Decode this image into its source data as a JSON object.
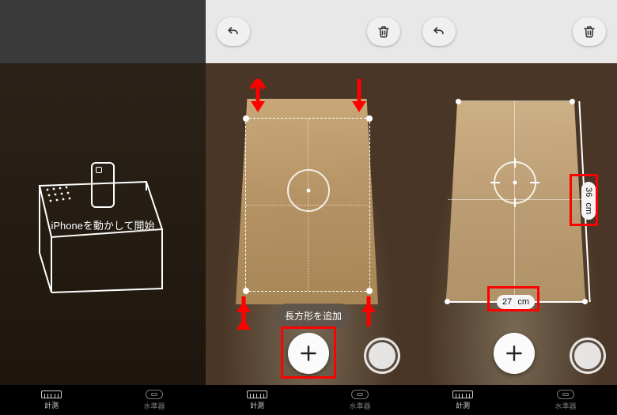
{
  "tabs": {
    "measure": "計測",
    "level": "水準器"
  },
  "panel1": {
    "instruction": "iPhoneを動かして開始"
  },
  "panel2": {
    "tooltip": "長方形を追加",
    "icons": {
      "undo": "undo-icon",
      "trash": "trash-icon",
      "plus": "plus-icon",
      "shutter": "shutter-icon"
    }
  },
  "panel3": {
    "measurements": {
      "width": {
        "value": "27",
        "unit": "cm"
      },
      "height": {
        "value": "36",
        "unit": "cm"
      }
    },
    "icons": {
      "undo": "undo-icon",
      "trash": "trash-icon",
      "plus": "plus-icon",
      "shutter": "shutter-icon"
    }
  }
}
